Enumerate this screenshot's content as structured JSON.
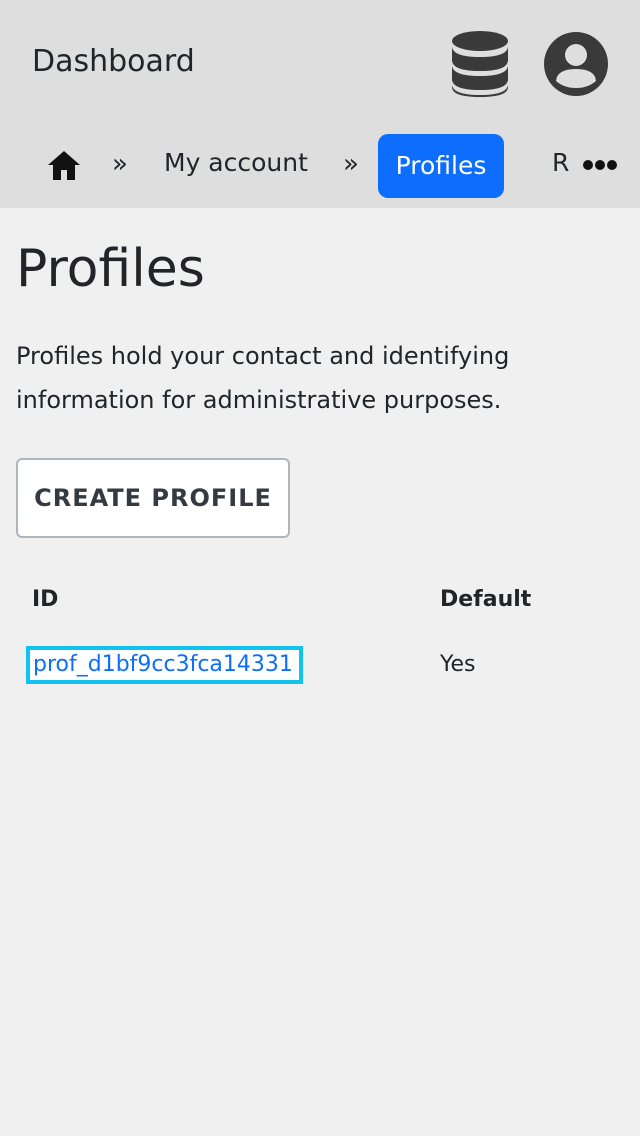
{
  "header": {
    "app_title": "Dashboard",
    "icons": {
      "database": "database-icon",
      "account": "account-circle-icon"
    }
  },
  "breadcrumb": {
    "home_icon": "home-icon",
    "separator": "»",
    "items": [
      {
        "label": "My account"
      },
      {
        "label": "Profiles",
        "active": true
      },
      {
        "label": "R"
      }
    ],
    "more_icon": "more-horizontal-icon"
  },
  "main": {
    "title": "Profiles",
    "description": "Profiles hold your contact and identifying information for administrative purposes.",
    "create_button": "CREATE PROFILE",
    "table": {
      "columns": [
        "ID",
        "Default"
      ],
      "rows": [
        {
          "id": "prof_d1bf9cc3fca14331",
          "default": "Yes"
        }
      ]
    }
  },
  "colors": {
    "header_bg": "#dedede",
    "page_bg": "#f0f0f0",
    "active_crumb": "#0d6efd",
    "link": "#0d6efd",
    "focus_outline": "#13c3ef"
  }
}
